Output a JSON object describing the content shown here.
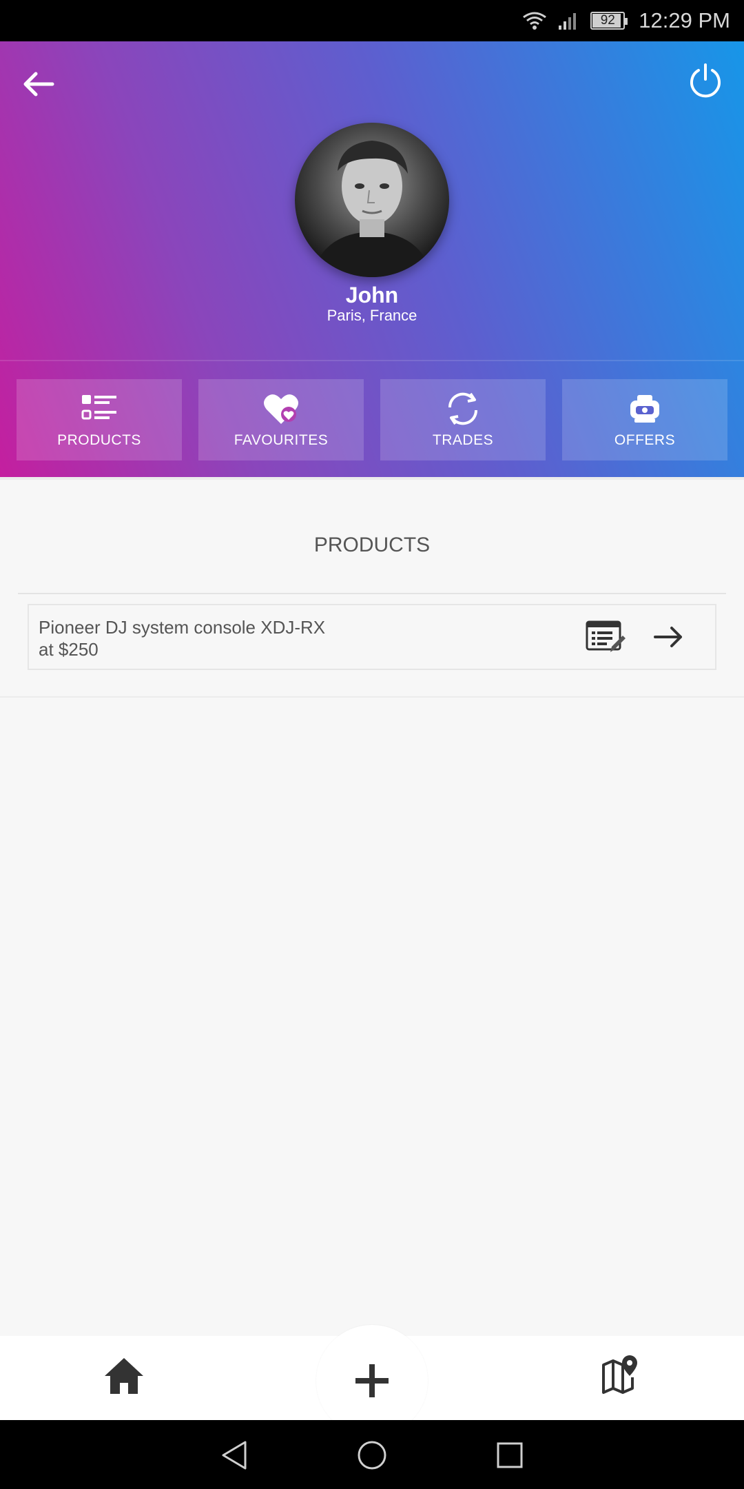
{
  "status_bar": {
    "battery_level": "92",
    "battery_fraction": 0.92,
    "time": "12:29 PM"
  },
  "header": {
    "back_icon": "back-arrow-icon",
    "power_icon": "power-icon",
    "gradient_colors": [
      "#c41f9f",
      "#5d5fcf",
      "#1796e8"
    ]
  },
  "profile": {
    "name": "John",
    "location": "Paris, France"
  },
  "tabs": [
    {
      "label": "PRODUCTS",
      "icon": "list-icon"
    },
    {
      "label": "FAVOURITES",
      "icon": "heart-icon"
    },
    {
      "label": "TRADES",
      "icon": "sync-icon"
    },
    {
      "label": "OFFERS",
      "icon": "offer-icon"
    }
  ],
  "products_section": {
    "title": "PRODUCTS",
    "items": [
      {
        "line1": "Pioneer DJ system console XDJ-RX",
        "line2": "at $250"
      }
    ]
  },
  "bottom_nav": {
    "icons": [
      "home-icon",
      "add-icon",
      "map-pin-icon"
    ]
  },
  "system_nav": {
    "icons": [
      "nav-back-icon",
      "nav-home-icon",
      "nav-recents-icon"
    ]
  }
}
